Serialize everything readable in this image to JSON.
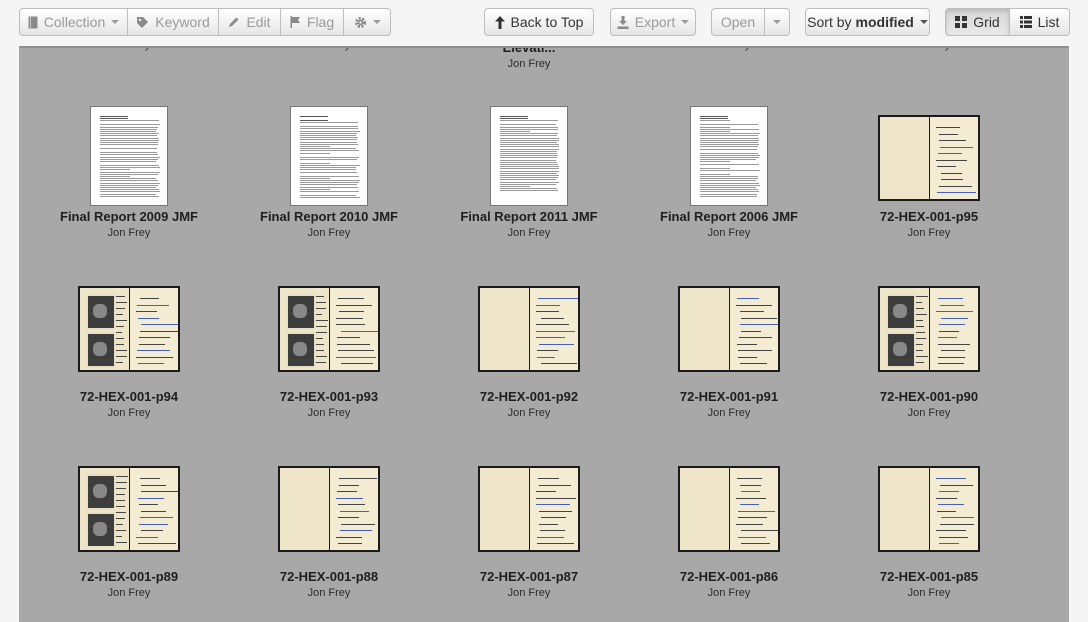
{
  "toolbar": {
    "collection": "Collection",
    "keyword": "Keyword",
    "edit": "Edit",
    "flag": "Flag",
    "back_to_top": "Back to Top",
    "export": "Export",
    "open": "Open",
    "sort_prefix": "Sort by",
    "sort_value": "modified",
    "grid": "Grid",
    "list": "List"
  },
  "partial_row": [
    {
      "title": "",
      "author": "Jon Frey"
    },
    {
      "title": "",
      "author": "Jon Frey"
    },
    {
      "title": "Elevati...",
      "author": "Jon Frey"
    },
    {
      "title": "",
      "author": "Jon Frey"
    },
    {
      "title": "",
      "author": "Jon Frey"
    }
  ],
  "rows": [
    [
      {
        "title": "Final Report 2009 JMF",
        "author": "Jon Frey",
        "kind": "document"
      },
      {
        "title": "Final Report 2010 JMF",
        "author": "Jon Frey",
        "kind": "document"
      },
      {
        "title": "Final Report 2011 JMF",
        "author": "Jon Frey",
        "kind": "document"
      },
      {
        "title": "Final Report 2006 JMF",
        "author": "Jon Frey",
        "kind": "document"
      },
      {
        "title": "72-HEX-001-p95",
        "author": "Jon Frey",
        "kind": "notebook"
      }
    ],
    [
      {
        "title": "72-HEX-001-p94",
        "author": "Jon Frey",
        "kind": "notebook-photo"
      },
      {
        "title": "72-HEX-001-p93",
        "author": "Jon Frey",
        "kind": "notebook-photo"
      },
      {
        "title": "72-HEX-001-p92",
        "author": "Jon Frey",
        "kind": "notebook"
      },
      {
        "title": "72-HEX-001-p91",
        "author": "Jon Frey",
        "kind": "notebook"
      },
      {
        "title": "72-HEX-001-p90",
        "author": "Jon Frey",
        "kind": "notebook-photo"
      }
    ],
    [
      {
        "title": "72-HEX-001-p89",
        "author": "Jon Frey",
        "kind": "notebook-photo"
      },
      {
        "title": "72-HEX-001-p88",
        "author": "Jon Frey",
        "kind": "notebook"
      },
      {
        "title": "72-HEX-001-p87",
        "author": "Jon Frey",
        "kind": "notebook"
      },
      {
        "title": "72-HEX-001-p86",
        "author": "Jon Frey",
        "kind": "notebook"
      },
      {
        "title": "72-HEX-001-p85",
        "author": "Jon Frey",
        "kind": "notebook"
      }
    ]
  ]
}
